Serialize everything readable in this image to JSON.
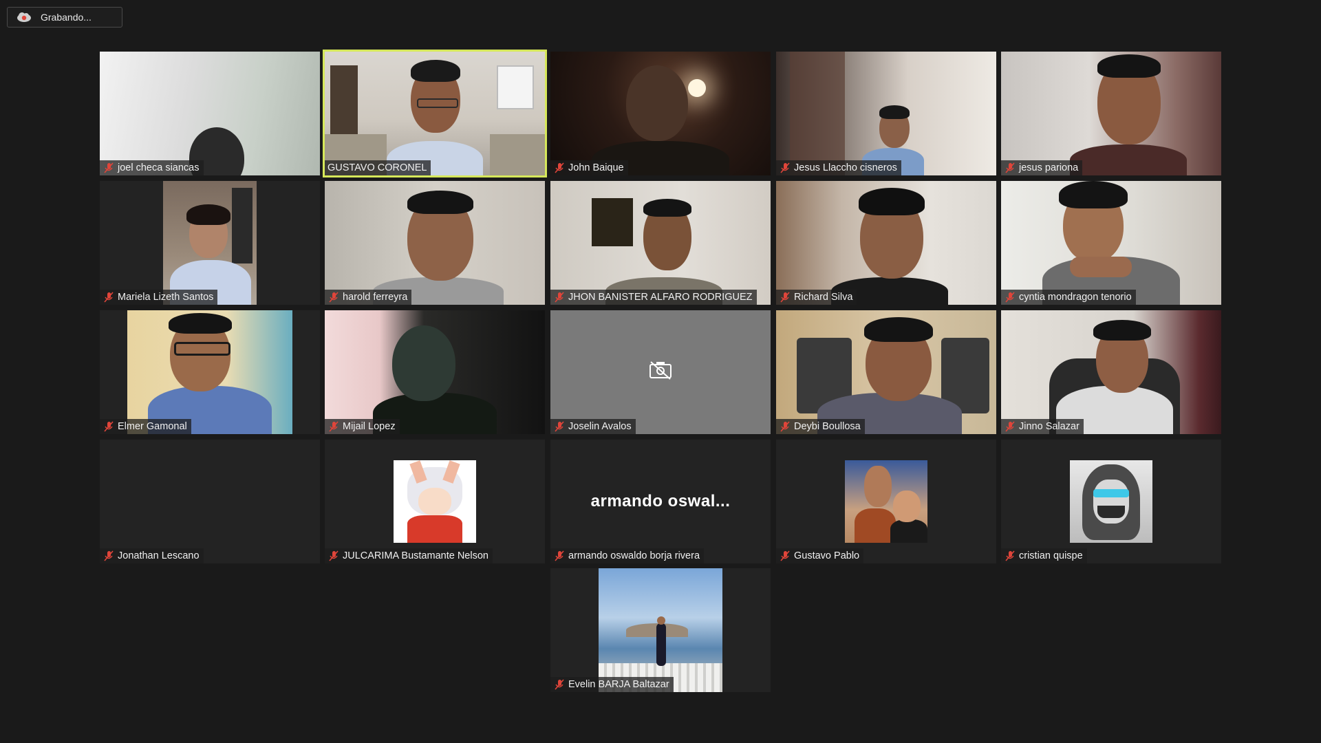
{
  "recording": {
    "label": "Grabando..."
  },
  "participants": [
    {
      "name": "joel checa siancas"
    },
    {
      "name": "GUSTAVO CORONEL"
    },
    {
      "name": "John Baique"
    },
    {
      "name": "Jesus Llaccho cisneros"
    },
    {
      "name": "jesus pariona"
    },
    {
      "name": "Mariela Lizeth Santos"
    },
    {
      "name": "harold ferreyra"
    },
    {
      "name": "JHON BANISTER ALFARO RODRIGUEZ"
    },
    {
      "name": "Richard Silva"
    },
    {
      "name": "cyntia mondragon tenorio"
    },
    {
      "name": "Elmer Gamonal"
    },
    {
      "name": "Mijail Lopez"
    },
    {
      "name": "Joselin Avalos",
      "camera_icon": "camera-off-icon"
    },
    {
      "name": "Deybi Boullosa"
    },
    {
      "name": "Jinno Salazar"
    },
    {
      "name": "Jonathan Lescano"
    },
    {
      "name": "JULCARIMA Bustamante Nelson"
    },
    {
      "name": "armando oswaldo borja rivera",
      "display_name": "armando  oswal..."
    },
    {
      "name": "Gustavo Pablo"
    },
    {
      "name": "cristian quispe"
    },
    {
      "name": "Evelin BARJA  Baltazar"
    }
  ],
  "icons": {
    "muted": "mic-muted-icon",
    "recording": "cloud-record-icon"
  },
  "colors": {
    "background": "#1a1a1a",
    "active_speaker_border": "#d6e85a",
    "muted_icon": "#e0453a"
  }
}
